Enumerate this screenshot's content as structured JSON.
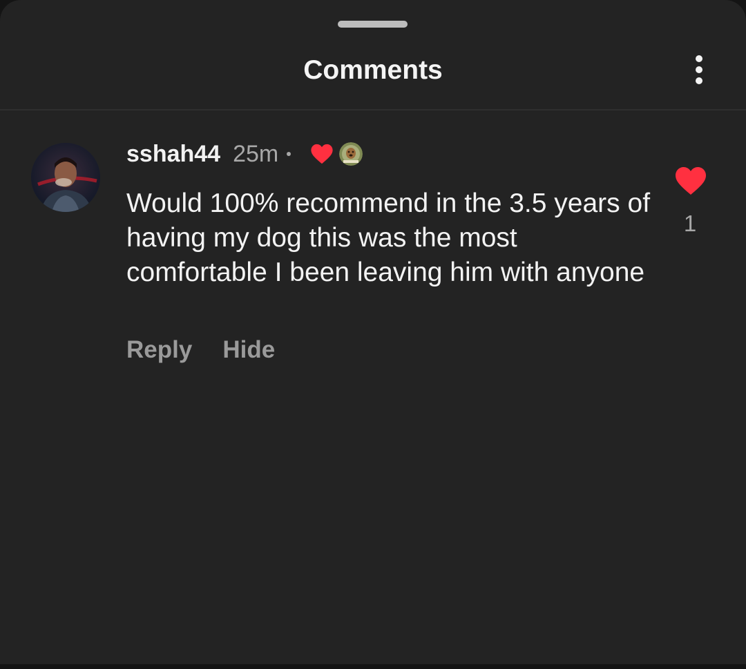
{
  "header": {
    "title": "Comments",
    "more_icon": "more-vertical-icon"
  },
  "comment": {
    "username": "sshah44",
    "time": "25m",
    "creator_liked_icon": "heart-icon",
    "text": "Would 100% recommend in the 3.5 years of having my dog this was the most comfortable I been leaving him with anyone",
    "actions": {
      "reply": "Reply",
      "hide": "Hide"
    },
    "like_icon": "heart-icon",
    "like_count": "1"
  },
  "colors": {
    "sheet_background": "#232323",
    "heart": "#ff3040",
    "muted_text": "#a8a8a8",
    "primary_text": "#f3f3f3"
  }
}
